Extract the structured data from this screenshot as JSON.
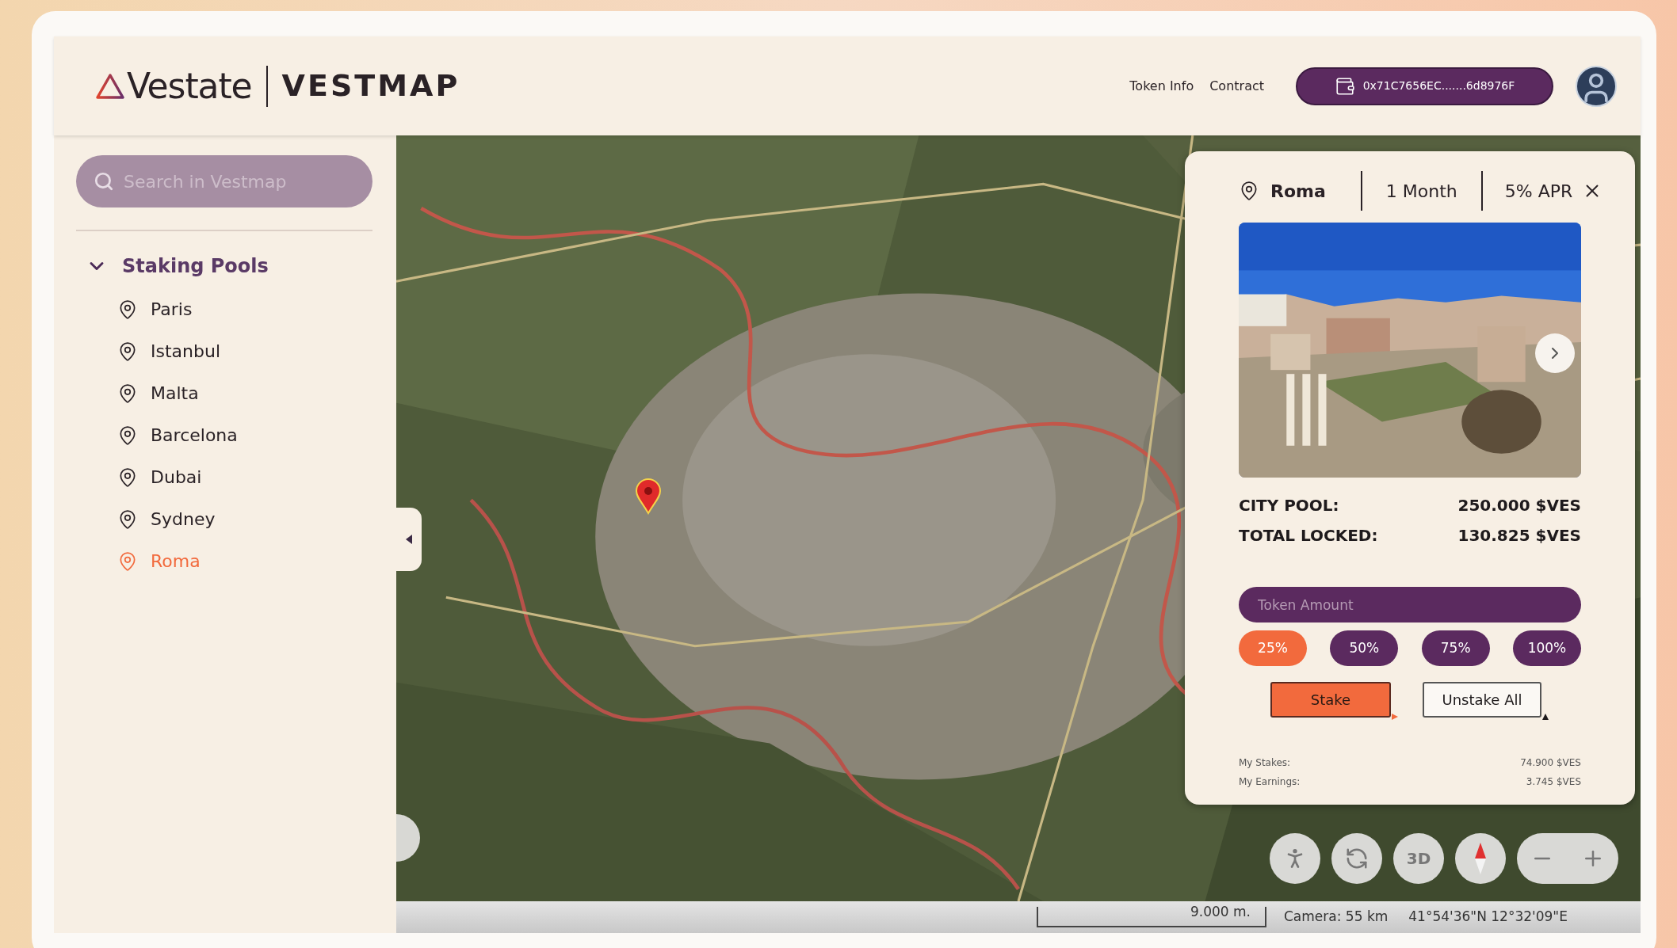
{
  "header": {
    "logo": "Vestate",
    "product": "VESTMAP",
    "nav": [
      "Token Info",
      "Contract"
    ],
    "wallet": "0x71C7656EC.......6d8976F"
  },
  "sidebar": {
    "search": {
      "placeholder": "Search in Vestmap"
    },
    "section": {
      "title": "Staking Pools",
      "expanded": true,
      "items": [
        {
          "label": "Paris",
          "selected": false
        },
        {
          "label": "Istanbul",
          "selected": false
        },
        {
          "label": "Malta",
          "selected": false
        },
        {
          "label": "Barcelona",
          "selected": false
        },
        {
          "label": "Dubai",
          "selected": false
        },
        {
          "label": "Sydney",
          "selected": false
        },
        {
          "label": "Roma",
          "selected": true
        }
      ]
    }
  },
  "pool_card": {
    "location": "Roma",
    "duration": "1 Month",
    "apr": "5% APR",
    "stats": [
      {
        "label": "CITY POOL:",
        "value": "250.000 $VES"
      },
      {
        "label": "TOTAL LOCKED:",
        "value": "130.825 $VES"
      }
    ],
    "token_field": {
      "placeholder": "Token Amount"
    },
    "percentages": [
      {
        "label": "25%",
        "selected": true
      },
      {
        "label": "50%",
        "selected": false
      },
      {
        "label": "75%",
        "selected": false
      },
      {
        "label": "100%",
        "selected": false
      }
    ],
    "actions": [
      {
        "label": "Stake",
        "kind": "primary"
      },
      {
        "label": "Unstake All",
        "kind": "secondary"
      }
    ],
    "my_stats": [
      {
        "label": "My Stakes:",
        "value": "74.900 $VES"
      },
      {
        "label": "My Earnings:",
        "value": "3.745 $VES"
      }
    ]
  },
  "map_controls": {
    "view_3d": "3D"
  },
  "status_bar": {
    "scale": "9.000 m.",
    "camera": "Camera: 55 km",
    "coordinates": "41°54'36\"N 12°32'09\"E"
  }
}
